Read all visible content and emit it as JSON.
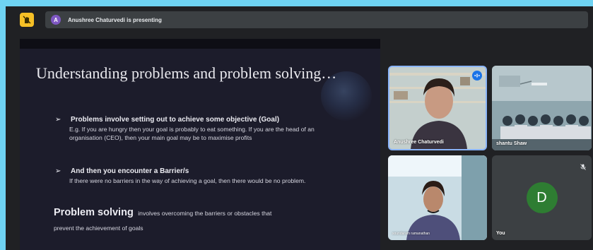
{
  "topbar": {
    "presenter_avatar_letter": "A",
    "presenting_text": "Anushree Chaturvedi is presenting"
  },
  "slide": {
    "title": "Understanding problems and problem solving…",
    "bullets": [
      {
        "arrow": "➢",
        "heading": "Problems involve setting out to achieve some objective (Goal)",
        "body": "E.g. If you are hungry then your goal is probably to eat something. If you are the head of an organisation (CEO), then your main goal may be to maximise profits"
      },
      {
        "arrow": "➢",
        "heading": "And then you encounter a Barrier/s",
        "body": "If there were no barriers in the way of achieving a goal, then there would be no problem."
      }
    ],
    "problem_solving_bold": "Problem solving",
    "problem_solving_rest": "involves overcoming the barriers or obstacles that",
    "problem_solving_line2": "prevent the achievement of goals"
  },
  "participants": [
    {
      "name": "Anushree Chaturvedi",
      "speaking": true
    },
    {
      "name": "shantu Shaw"
    },
    {
      "name": "soundaram ramanathan"
    },
    {
      "name": "You",
      "avatar_letter": "D",
      "muted": true
    }
  ],
  "colors": {
    "background": "#6fd3f3",
    "app": "#202124",
    "hand_button": "#f6c026",
    "presenter_avatar": "#7e57c2",
    "speaking_border": "#8ab4f8",
    "you_avatar": "#2e7d32"
  }
}
